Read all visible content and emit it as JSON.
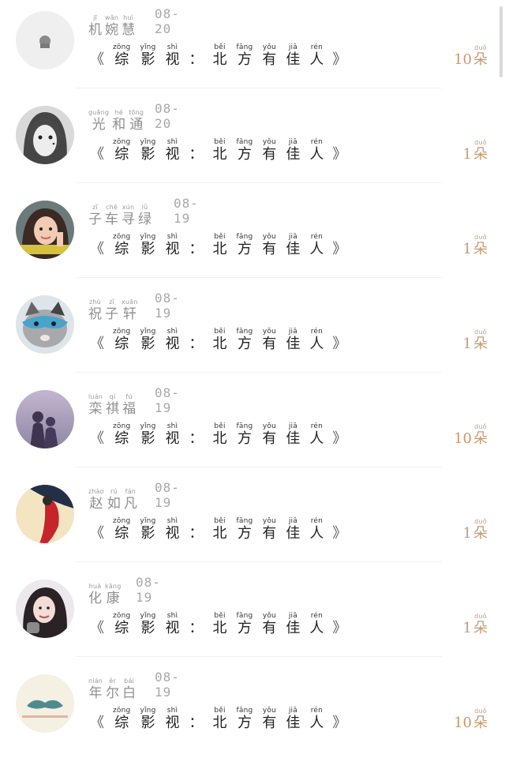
{
  "message": {
    "open": "《",
    "close": "》",
    "chars": [
      {
        "py": "zōng",
        "hz": "综"
      },
      {
        "py": "yǐng",
        "hz": "影"
      },
      {
        "py": "shì",
        "hz": "视"
      },
      {
        "py": "",
        "hz": "："
      },
      {
        "py": "běi",
        "hz": "北"
      },
      {
        "py": "fāng",
        "hz": "方"
      },
      {
        "py": "yǒu",
        "hz": "有"
      },
      {
        "py": "jiā",
        "hz": "佳"
      },
      {
        "py": "rén",
        "hz": "人"
      }
    ]
  },
  "gift_unit": {
    "py": "duǒ",
    "hz": "朵"
  },
  "rows": [
    {
      "name": [
        {
          "py": "jī",
          "hz": "机"
        },
        {
          "py": "wǎn",
          "hz": "婉"
        },
        {
          "py": "huì",
          "hz": "慧"
        }
      ],
      "date": "08-20",
      "count": "10",
      "avatar": "default"
    },
    {
      "name": [
        {
          "py": "guāng",
          "hz": "光"
        },
        {
          "py": "hé",
          "hz": "和"
        },
        {
          "py": "tōng",
          "hz": "通"
        }
      ],
      "date": "08-20",
      "count": "1",
      "avatar": "girl-bw"
    },
    {
      "name": [
        {
          "py": "zǐ",
          "hz": "子"
        },
        {
          "py": "chē",
          "hz": "车"
        },
        {
          "py": "xún",
          "hz": "寻"
        },
        {
          "py": "lǜ",
          "hz": "绿"
        }
      ],
      "date": "08-19",
      "count": "1",
      "avatar": "girl-peace"
    },
    {
      "name": [
        {
          "py": "zhù",
          "hz": "祝"
        },
        {
          "py": "zǐ",
          "hz": "子"
        },
        {
          "py": "xuān",
          "hz": "轩"
        }
      ],
      "date": "08-19",
      "count": "1",
      "avatar": "cat-mask"
    },
    {
      "name": [
        {
          "py": "luán",
          "hz": "栾"
        },
        {
          "py": "qí",
          "hz": "祺"
        },
        {
          "py": "fú",
          "hz": "福"
        }
      ],
      "date": "08-19",
      "count": "10",
      "avatar": "couple"
    },
    {
      "name": [
        {
          "py": "zhào",
          "hz": "赵"
        },
        {
          "py": "rú",
          "hz": "如"
        },
        {
          "py": "fán",
          "hz": "凡"
        }
      ],
      "date": "08-19",
      "count": "1",
      "avatar": "red-dress"
    },
    {
      "name": [
        {
          "py": "huà",
          "hz": "化"
        },
        {
          "py": "kāng",
          "hz": "康"
        }
      ],
      "date": "08-19",
      "count": "1",
      "avatar": "girl-smile"
    },
    {
      "name": [
        {
          "py": "nián",
          "hz": "年"
        },
        {
          "py": "ěr",
          "hz": "尔"
        },
        {
          "py": "bái",
          "hz": "白"
        }
      ],
      "date": "08-19",
      "count": "10",
      "avatar": "mustache"
    }
  ]
}
